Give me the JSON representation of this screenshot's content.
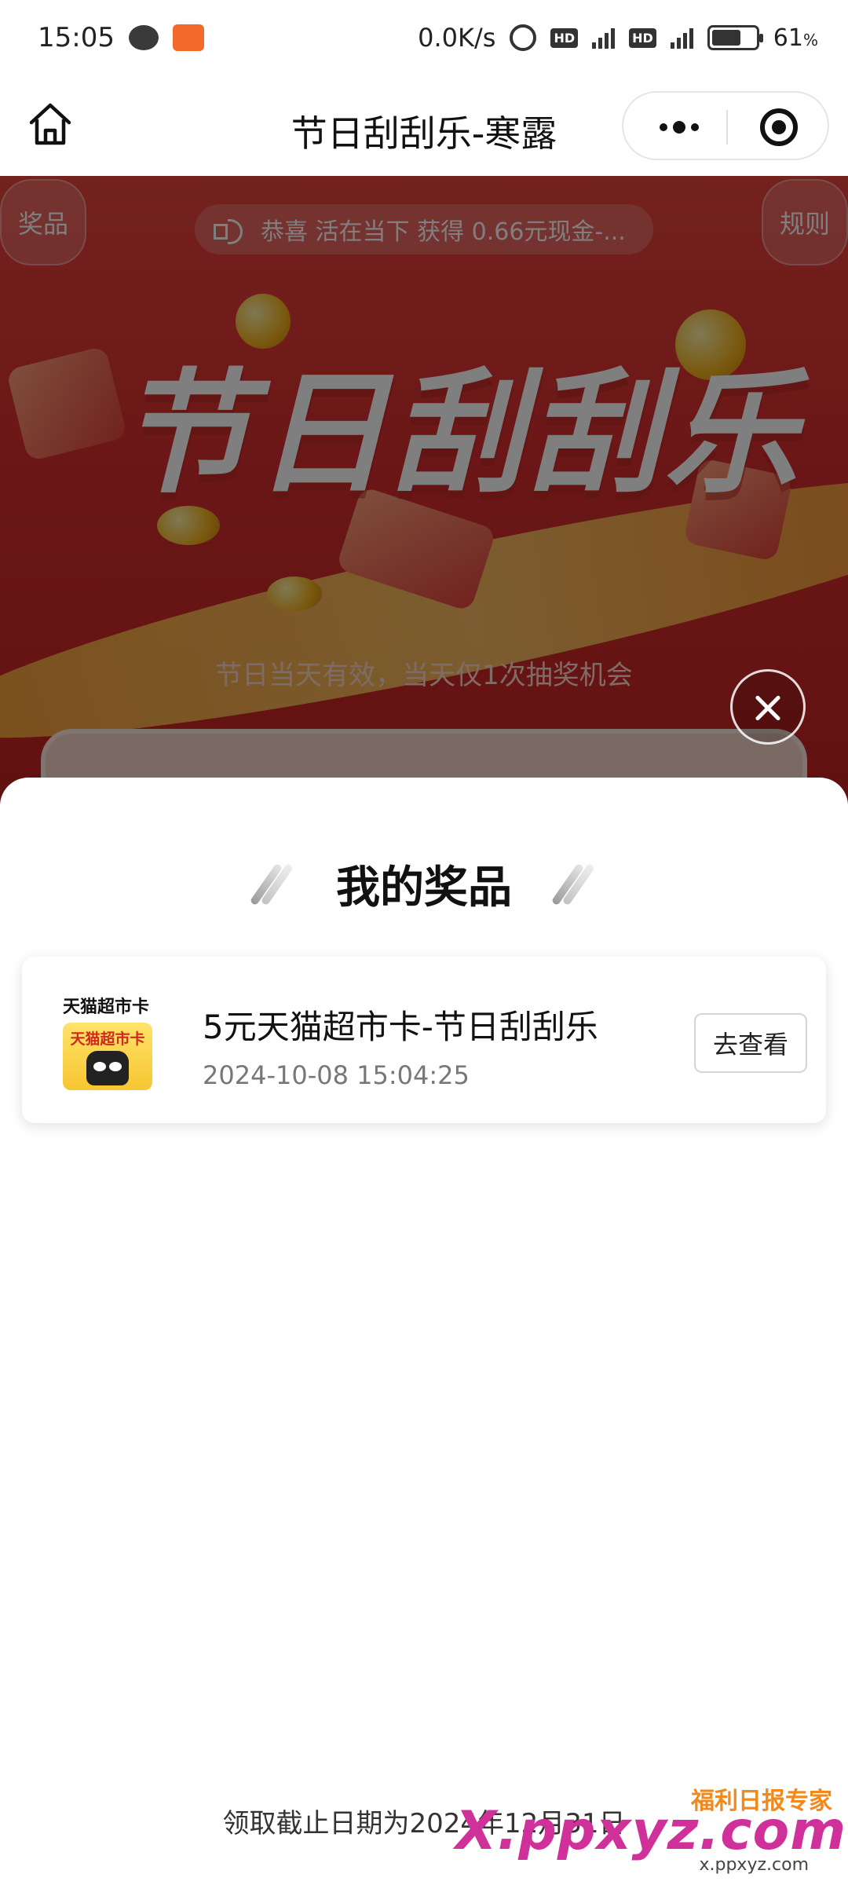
{
  "status_bar": {
    "time": "15:05",
    "net_speed": "0.0K/s",
    "hd1": "HD",
    "hd2": "HD",
    "net1": "4G",
    "net2": "4G",
    "battery_percent": 61,
    "battery_text": "61"
  },
  "titlebar": {
    "title": "节日刮刮乐-寒露",
    "icons": [
      "home-icon",
      "more-icon",
      "close-miniprogram-icon"
    ]
  },
  "banner": {
    "prizes_button": "奖品",
    "rules_button": "规则",
    "marquee": "恭喜 活在当下 获得 0.66元现金-...",
    "headline": "节日刮刮乐",
    "subtitle": "节日当天有效，当天仅1次抽奖机会"
  },
  "sheet": {
    "title": "我的奖品",
    "prizes": [
      {
        "thumb_label": "天猫超市卡",
        "thumb_card_text": "天猫超市卡",
        "name": "5元天猫超市卡-节日刮刮乐",
        "time": "2024-10-08 15:04:25",
        "action": "去查看"
      }
    ],
    "deadline": "领取截止日期为2024年12月31日"
  },
  "watermark": {
    "logo": "福利日报专家",
    "text": "X.ppxyz.com",
    "url": "x.ppxyz.com"
  }
}
